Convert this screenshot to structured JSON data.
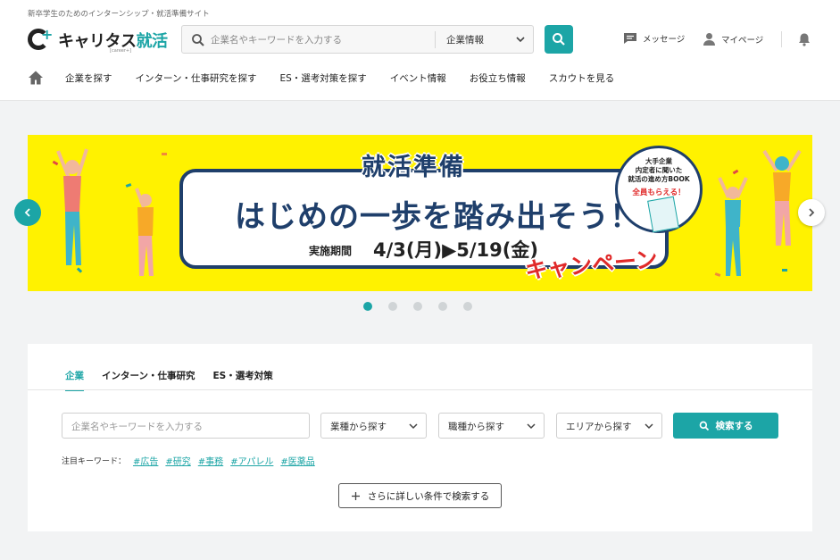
{
  "header": {
    "tagline": "新卒学生のためのインターンシップ・就活準備サイト",
    "logo_main": "キャリタス",
    "logo_accent": "就活",
    "logo_sub": "[career+]",
    "search_placeholder": "企業名やキーワードを入力する",
    "search_category": "企業情報",
    "messages_label": "メッセージ",
    "mypage_label": "マイページ"
  },
  "nav": {
    "items": [
      "企業を探す",
      "インターン・仕事研究を探す",
      "ES・選考対策を探す",
      "イベント情報",
      "お役立ち情報",
      "スカウトを見る"
    ]
  },
  "banner": {
    "title_small": "就活準備",
    "title_main": "はじめの一歩を踏み出そう！",
    "period_label": "実施期間",
    "period_value": "4/3(月)▶5/19(金)",
    "campaign": "キャンペーン",
    "badge_line1": "大手企業",
    "badge_line2": "内定者に聞いた",
    "badge_line3": "就活の進め方BOOK",
    "badge_highlight": "全員もらえる！",
    "slide_count": 5,
    "active_slide": 1
  },
  "search_panel": {
    "tabs": [
      "企業",
      "インターン・仕事研究",
      "ES・選考対策"
    ],
    "active_tab": 0,
    "keyword_placeholder": "企業名やキーワードを入力する",
    "industry_select": "業種から探す",
    "job_select": "職種から探す",
    "area_select": "エリアから探す",
    "search_button": "検索する",
    "featured_label": "注目キーワード：",
    "featured_tags": [
      "#広告",
      "#研究",
      "#事務",
      "#アパレル",
      "#医薬品"
    ],
    "more_button": "さらに詳しい条件で検索する"
  },
  "colors": {
    "accent": "#1ca5a6",
    "banner_bg": "#fff200",
    "navy": "#1f3f6b",
    "campaign_red": "#e02a2a"
  },
  "icons": [
    "search-icon",
    "chevron-down-icon",
    "message-icon",
    "user-icon",
    "bell-icon",
    "home-icon",
    "arrow-left-icon",
    "arrow-right-icon",
    "plus-icon"
  ]
}
